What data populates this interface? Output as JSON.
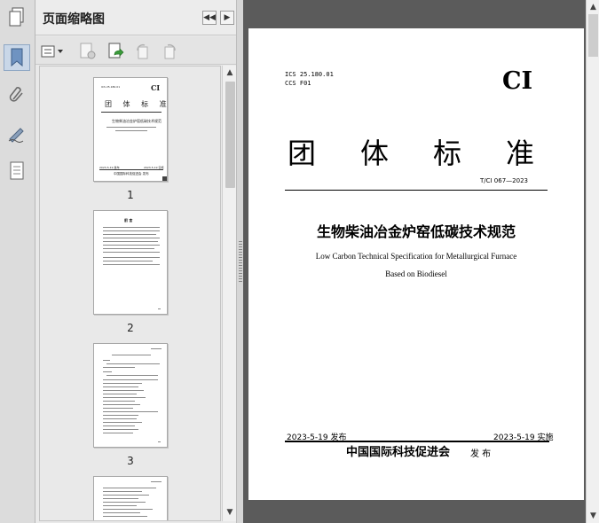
{
  "panel": {
    "title": "页面缩略图",
    "collapse_label": "◀◀",
    "next_label": "▶"
  },
  "rail": {
    "items": [
      "bookmarks",
      "attachments",
      "signatures",
      "pages"
    ]
  },
  "thumbnails": [
    {
      "page_number": "1"
    },
    {
      "page_number": "2"
    },
    {
      "page_number": "3"
    }
  ],
  "thumb1": {
    "logo": "CI",
    "header_left": "ICS 25.180.01",
    "title": "团 体 标 准",
    "subtitle": "生物柴油冶金炉窑低碳技术规范",
    "pub_date": "2023-5-19 发布",
    "impl_date": "2023-5-19 实施",
    "issuer": "中国国际科技促进会 发布"
  },
  "thumb2": {
    "heading": "前 言"
  },
  "document": {
    "ics": "ICS 25.180.01",
    "ccs": "CCS F01",
    "logo": "CI",
    "title": "团体标准",
    "standard_no": "T/CI 067—2023",
    "title_cn": "生物柴油冶金炉窑低碳技术规范",
    "title_en_1": "Low Carbon Technical Specification for Metallurgical Furnace",
    "title_en_2": "Based on Biodiesel",
    "publish_date": "2023-5-19 发布",
    "implement_date": "2023-5-19 实施",
    "issuer": "中国国际科技促进会",
    "issue_word": "发 布"
  },
  "colors": {
    "document_background": "#5b5b5b",
    "panel_background": "#e9e9e9"
  }
}
